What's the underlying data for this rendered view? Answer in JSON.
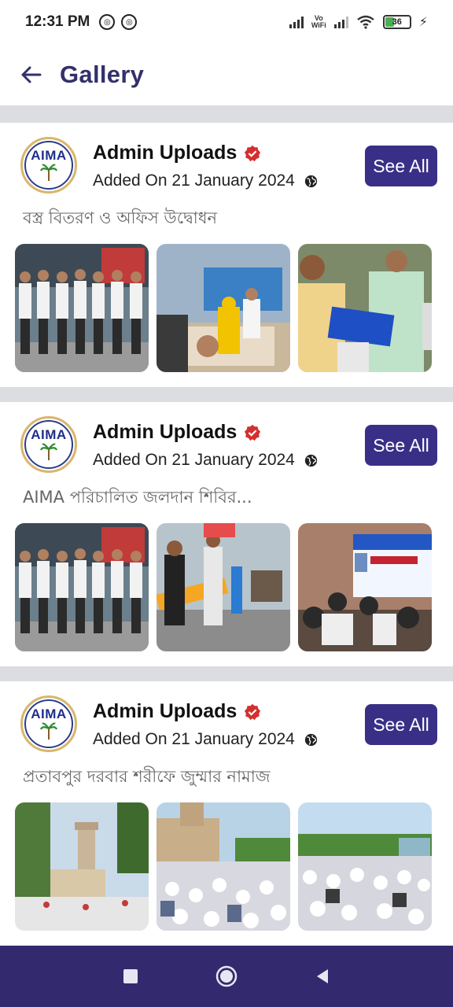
{
  "status_bar": {
    "time": "12:31 PM",
    "vowifi_top": "Vo",
    "vowifi_bottom": "WiFi",
    "battery": "36"
  },
  "app_bar": {
    "title": "Gallery"
  },
  "logo_text": "AIMA",
  "posts": [
    {
      "uploader": "Admin Uploads",
      "added": "Added On 21 January 2024",
      "see_all": "See All",
      "caption": "বস্ত্র বিতরণ ও অফিস উদ্বোধন",
      "thumbnails": [
        "group-photo",
        "distribution-event",
        "handover-photo"
      ]
    },
    {
      "uploader": "Admin Uploads",
      "added": "Added On 21 January 2024",
      "see_all": "See All",
      "caption": "AIMA পরিচালিত জলদান শিবির...",
      "thumbnails": [
        "group-photo",
        "water-camp",
        "banner-gathering"
      ]
    },
    {
      "uploader": "Admin Uploads",
      "added": "Added On 21 January 2024",
      "see_all": "See All",
      "caption": "প্রতাবপুর দরবার শরীফে জুম্মার নামাজ",
      "thumbnails": [
        "mosque-tower",
        "mosque-crowd",
        "prayer-crowd"
      ]
    }
  ],
  "colors": {
    "primary": "#3a2f87",
    "title": "#33306b",
    "nav_bar": "#33296e",
    "verified": "#d32f2f",
    "divider": "#dcdde1"
  },
  "icons": {
    "back": "back-arrow-icon",
    "verified": "verified-badge-icon",
    "globe": "globe-icon",
    "nav_recents": "square-icon",
    "nav_home": "circle-icon",
    "nav_back": "triangle-back-icon"
  }
}
